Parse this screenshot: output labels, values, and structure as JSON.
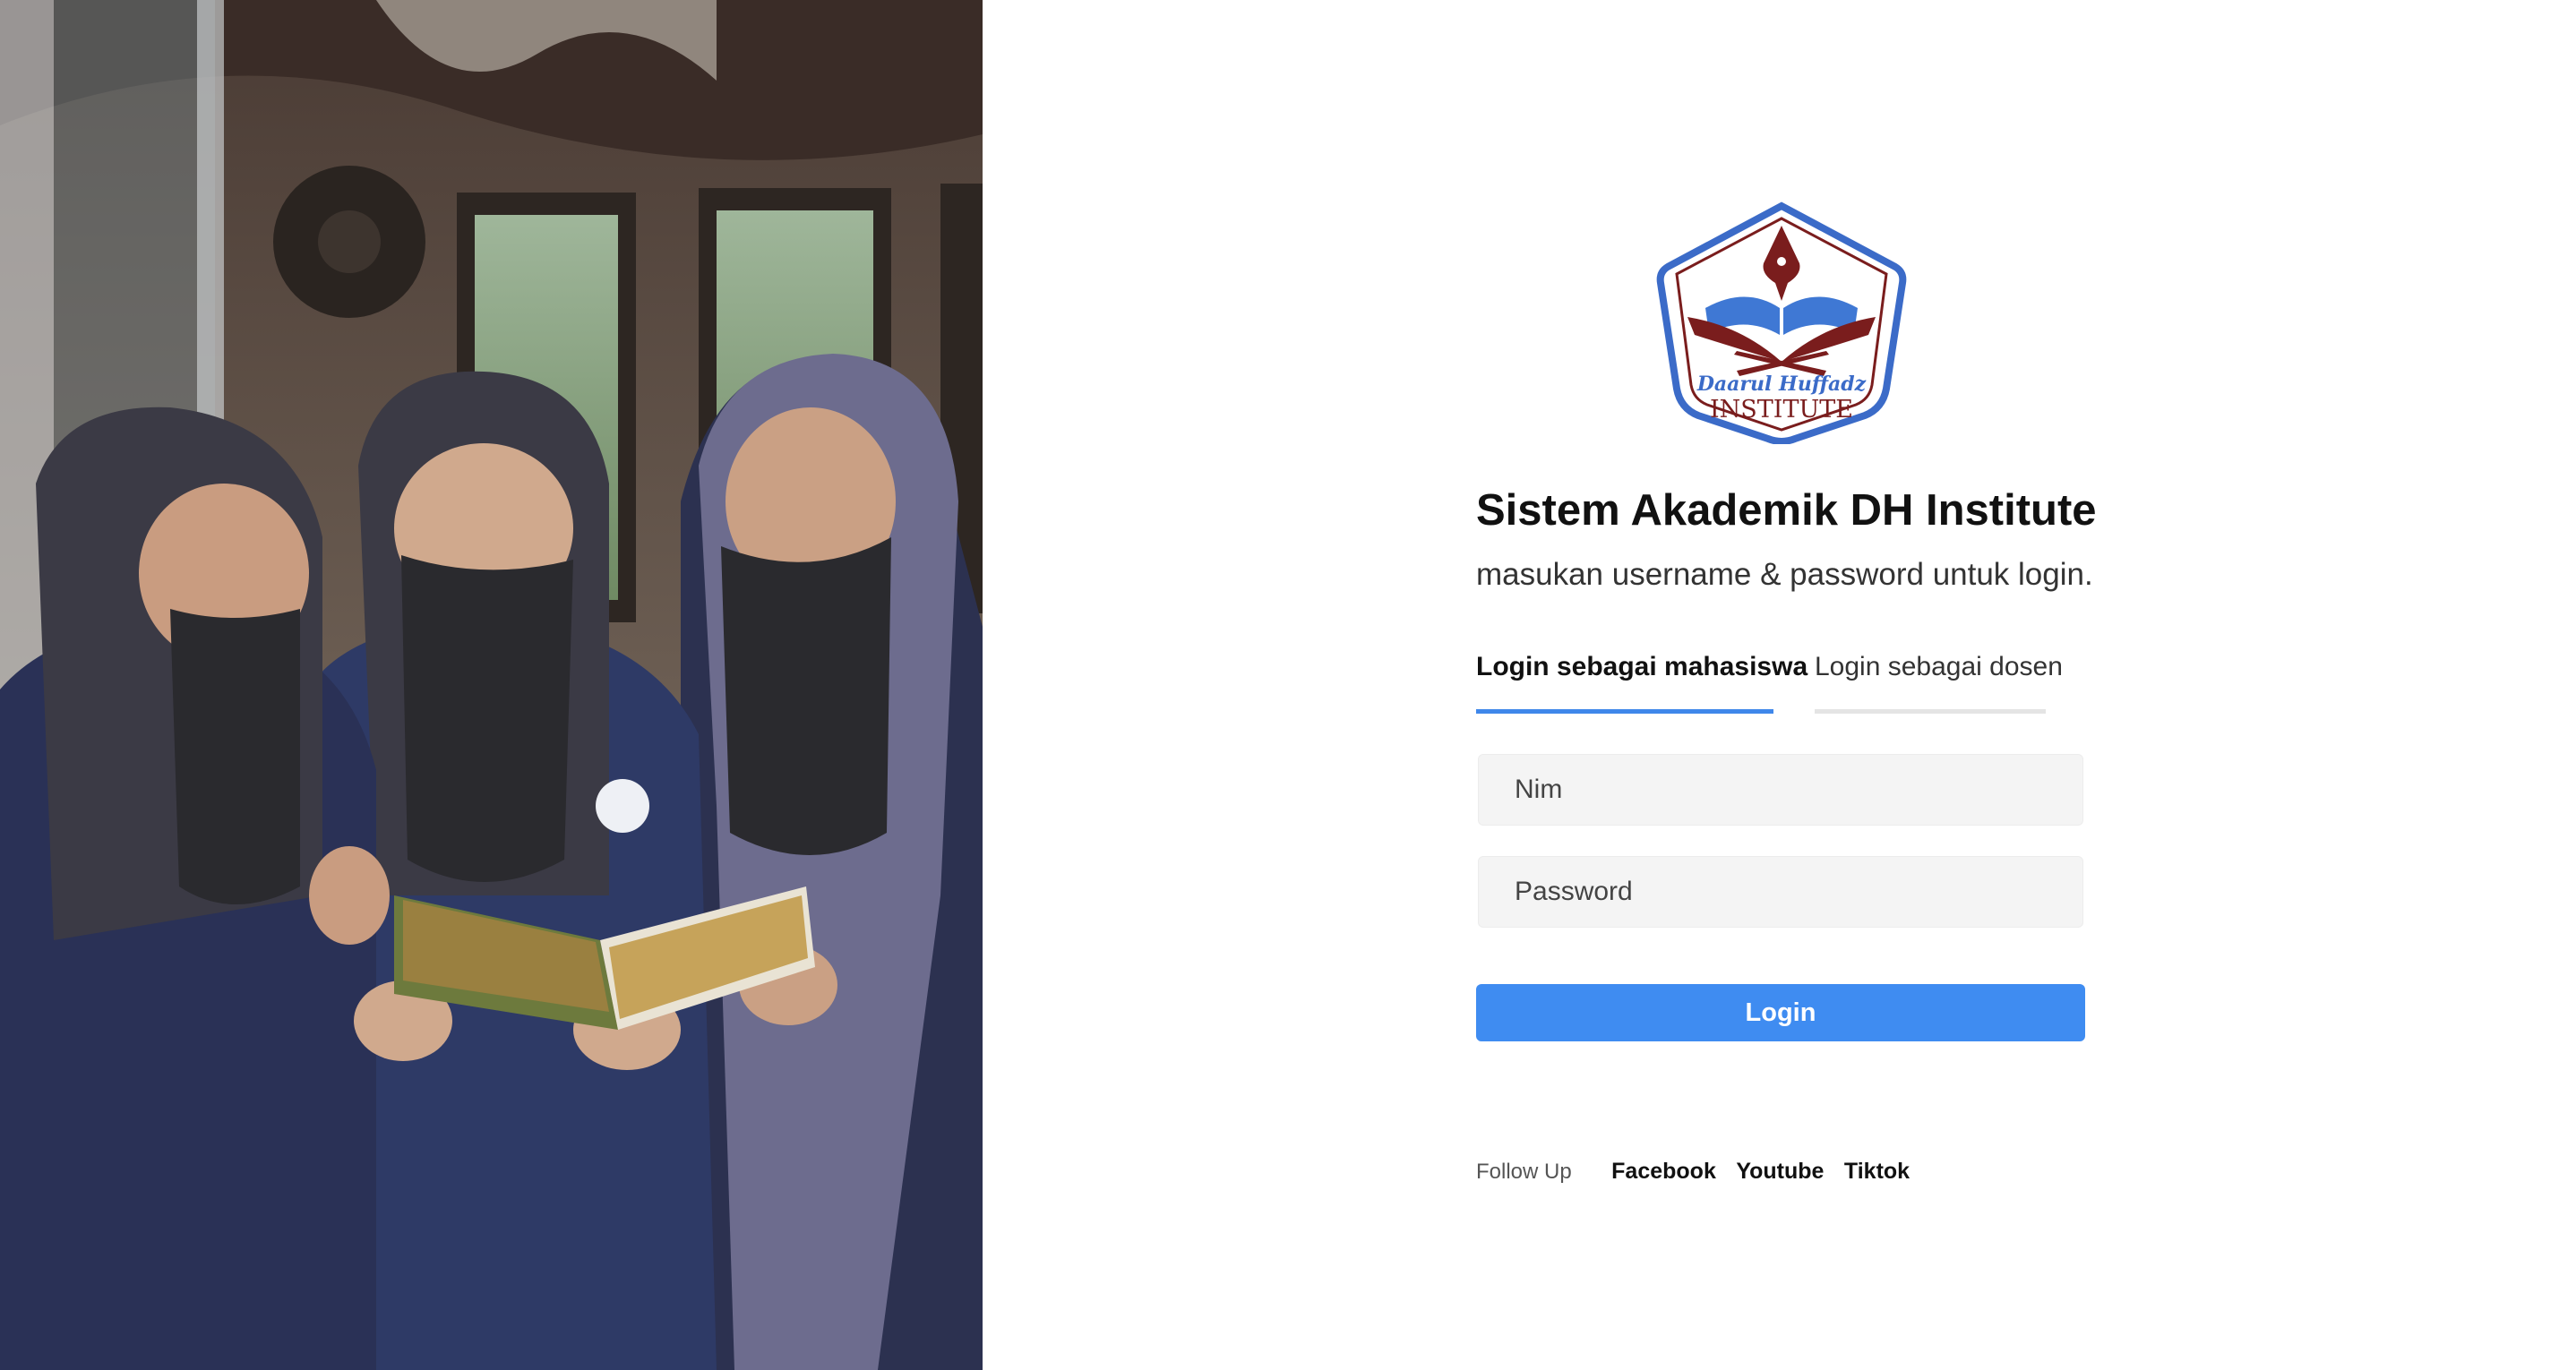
{
  "login": {
    "logo": {
      "line1": "Daarul Huffadz",
      "line2": "INSTITUTE",
      "colors": {
        "frame": "#3b6bc8",
        "accent": "#7a1d1d",
        "book": "#3f78d4"
      }
    },
    "title": "Sistem Akademik DH Institute",
    "subtitle": "masukan username & password untuk login.",
    "tabs": [
      {
        "label": "Login sebagai mahasiswa",
        "active": true
      },
      {
        "label": "Login sebagai dosen",
        "active": false
      }
    ],
    "nim_placeholder": "Nim",
    "password_placeholder": "Password",
    "submit_label": "Login"
  },
  "footer": {
    "follow_label": "Follow Up",
    "links": [
      "Facebook",
      "Youtube",
      "Tiktok"
    ]
  },
  "colors": {
    "accent": "#3f8cf1",
    "tab_underline_active": "#3f87ea",
    "tab_underline_inactive": "#e4e4e4",
    "field_bg": "#f4f4f4"
  }
}
